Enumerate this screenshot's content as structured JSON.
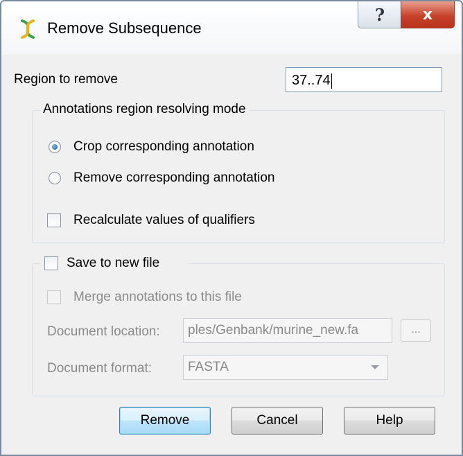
{
  "window": {
    "title": "Remove Subsequence",
    "help_glyph": "?",
    "close_glyph": "x"
  },
  "region": {
    "label": "Region to remove",
    "value": "37..74"
  },
  "annotations_group": {
    "title": "Annotations region resolving mode",
    "options": [
      {
        "label": "Crop corresponding annotation",
        "selected": true
      },
      {
        "label": "Remove corresponding annotation",
        "selected": false
      }
    ],
    "recalculate_label": "Recalculate values of qualifiers",
    "recalculate_checked": false
  },
  "save_group": {
    "title": "Save to new file",
    "checked": false,
    "merge_label": "Merge annotations to this file",
    "merge_checked": false,
    "location_label": "Document location:",
    "location_value": "ples/Genbank/murine_new.fa",
    "browse_label": "...",
    "format_label": "Document format:",
    "format_value": "FASTA"
  },
  "buttons": {
    "remove": "Remove",
    "cancel": "Cancel",
    "help": "Help"
  },
  "icons": {
    "app": "dna-helix-icon",
    "accent_green": "#3aa24a",
    "accent_yellow": "#e6b419"
  }
}
